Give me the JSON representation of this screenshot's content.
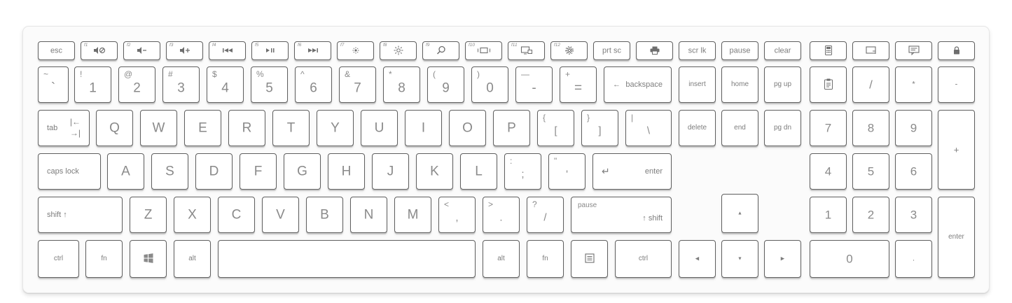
{
  "keyboard": {
    "body_color": "#fbfbfb",
    "key_border_color": "#5f5f5f",
    "legend_color": "#8a8a8a"
  },
  "function_row": {
    "esc": "esc",
    "f1": {
      "sub": "f1",
      "icon": "mute-icon"
    },
    "f2": {
      "sub": "f2",
      "icon": "volume-down-icon"
    },
    "f3": {
      "sub": "f3",
      "icon": "volume-up-icon"
    },
    "f4": {
      "sub": "f4",
      "icon": "previous-track-icon"
    },
    "f5": {
      "sub": "f5",
      "icon": "play-pause-icon"
    },
    "f6": {
      "sub": "f6",
      "icon": "next-track-icon"
    },
    "f7": {
      "sub": "f7",
      "icon": "brightness-down-icon"
    },
    "f8": {
      "sub": "f8",
      "icon": "brightness-up-icon"
    },
    "f9": {
      "sub": "f9",
      "icon": "search-icon"
    },
    "f10": {
      "sub": "f10",
      "icon": "window-icon"
    },
    "f11": {
      "sub": "f11",
      "icon": "display-switch-icon"
    },
    "f12": {
      "sub": "f12",
      "icon": "settings-icon"
    },
    "prtsc": "prt sc",
    "print": {
      "icon": "print-icon"
    },
    "scrlk": "scr lk",
    "pause": "pause",
    "clear": "clear",
    "calc": {
      "icon": "calculator-icon"
    },
    "snip": {
      "icon": "snip-icon"
    },
    "notes": {
      "icon": "notes-icon"
    },
    "lock": {
      "icon": "lock-icon"
    }
  },
  "number_row": {
    "keys": [
      {
        "shift": "~",
        "base": "`"
      },
      {
        "shift": "!",
        "base": "1"
      },
      {
        "shift": "@",
        "base": "2"
      },
      {
        "shift": "#",
        "base": "3"
      },
      {
        "shift": "$",
        "base": "4"
      },
      {
        "shift": "%",
        "base": "5"
      },
      {
        "shift": "^",
        "base": "6"
      },
      {
        "shift": "&",
        "base": "7"
      },
      {
        "shift": "*",
        "base": "8"
      },
      {
        "shift": "(",
        "base": "9"
      },
      {
        "shift": ")",
        "base": "0"
      },
      {
        "shift": "—",
        "base": "-"
      },
      {
        "shift": "+",
        "base": "="
      }
    ],
    "backspace": "backspace",
    "insert": "insert",
    "home": "home",
    "pgup": "pg up",
    "clipboard": {
      "icon": "clipboard-icon"
    },
    "num_div": "/",
    "num_mul": "*",
    "num_minus": "-"
  },
  "qwerty_row": {
    "tab": "tab",
    "letters": [
      "Q",
      "W",
      "E",
      "R",
      "T",
      "Y",
      "U",
      "I",
      "O",
      "P"
    ],
    "bracket_open": {
      "shift": "{",
      "base": "["
    },
    "bracket_close": {
      "shift": "}",
      "base": "]"
    },
    "backslash": {
      "shift": "|",
      "base": "\\"
    },
    "delete": "delete",
    "end": "end",
    "pgdn": "pg dn",
    "num7": "7",
    "num8": "8",
    "num9": "9",
    "num_plus": "+"
  },
  "home_row": {
    "caps": "caps lock",
    "letters": [
      "A",
      "S",
      "D",
      "F",
      "G",
      "H",
      "J",
      "K",
      "L"
    ],
    "semicolon": {
      "shift": ":",
      "base": ";"
    },
    "quote": {
      "shift": "\"",
      "base": "'"
    },
    "enter": "enter",
    "num4": "4",
    "num5": "5",
    "num6": "6"
  },
  "shift_row": {
    "lshift": "shift ↑",
    "letters": [
      "Z",
      "X",
      "C",
      "V",
      "B",
      "N",
      "M"
    ],
    "comma": {
      "shift": "<",
      "base": ","
    },
    "period": {
      "shift": ">",
      "base": "."
    },
    "slash": {
      "shift": "?",
      "base": "/"
    },
    "rshift_top": "pause",
    "rshift": "↑ shift",
    "up_arrow": "▲",
    "num1": "1",
    "num2": "2",
    "num3": "3",
    "num_enter": "enter"
  },
  "bottom_row": {
    "lctrl": "ctrl",
    "fn": "fn",
    "win": {
      "icon": "windows-icon"
    },
    "lalt": "alt",
    "ralt": "alt",
    "rfn": "fn",
    "menu": {
      "icon": "menu-icon"
    },
    "rctrl": "ctrl",
    "left_arrow": "◀",
    "down_arrow": "▼",
    "right_arrow": "▶",
    "num0": "0",
    "num_dot": "."
  }
}
